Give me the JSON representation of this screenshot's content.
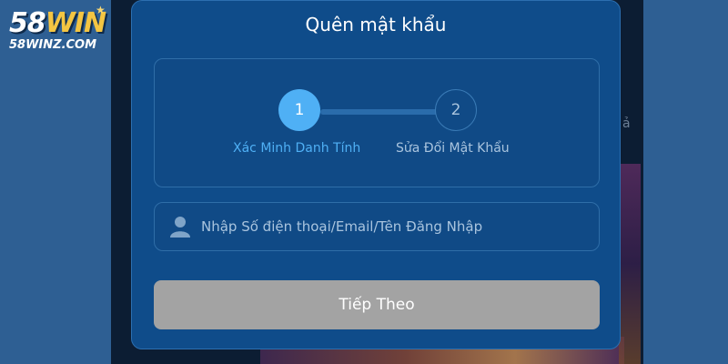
{
  "logo": {
    "brand_number": "58",
    "brand_word": "WIN",
    "domain": "58WINZ.COM"
  },
  "modal": {
    "title": "Quên mật khẩu",
    "steps": [
      {
        "number": "1",
        "label": "Xác Minh Danh Tính",
        "active": true
      },
      {
        "number": "2",
        "label": "Sửa Đổi Mật Khẩu",
        "active": false
      }
    ],
    "input": {
      "placeholder": "Nhập Số điện thoại/Email/Tên Đăng Nhập",
      "value": "",
      "icon": "user-icon"
    },
    "next_button": {
      "label": "Tiếp Theo",
      "enabled": false
    }
  },
  "background": {
    "right_hint": "ả"
  },
  "colors": {
    "page_bg": "#2e5f93",
    "modal_bg": "#0f4c8a",
    "active_step": "#4fb0f5",
    "inactive_text": "#a9c4de",
    "button_disabled": "#a3a3a3"
  }
}
